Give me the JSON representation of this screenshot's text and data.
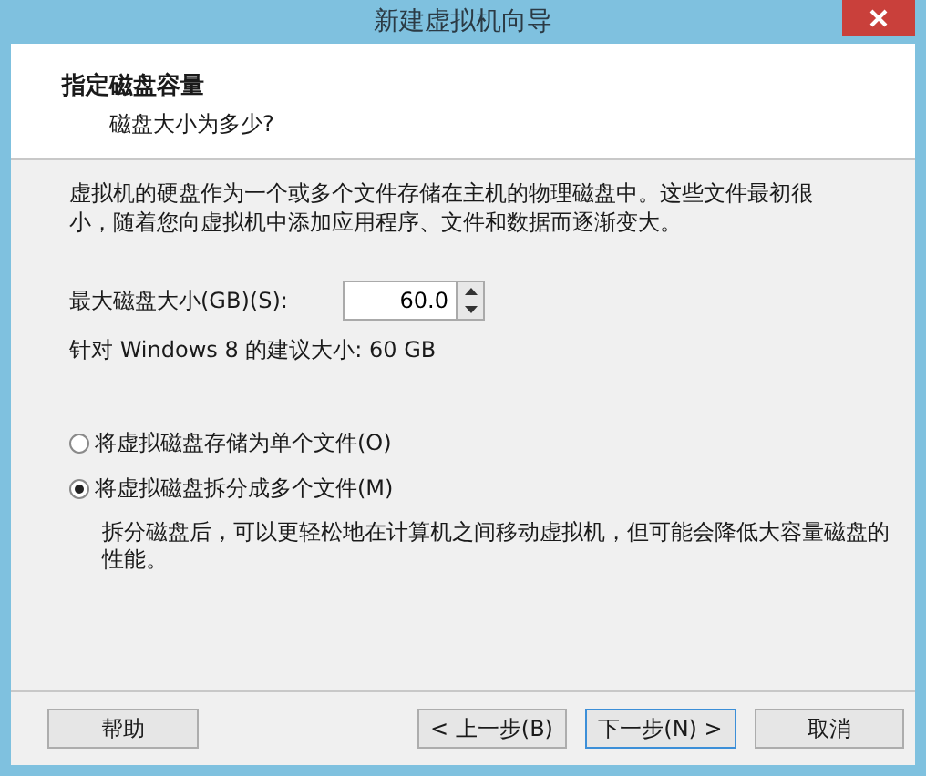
{
  "window": {
    "title": "新建虚拟机向导"
  },
  "header": {
    "title": "指定磁盘容量",
    "subtitle": "磁盘大小为多少?"
  },
  "description": "虚拟机的硬盘作为一个或多个文件存储在主机的物理磁盘中。这些文件最初很小，随着您向虚拟机中添加应用程序、文件和数据而逐渐变大。",
  "disk_size": {
    "label": "最大磁盘大小(GB)(S):",
    "value": "60.0"
  },
  "recommendation": "针对 Windows 8 的建议大小: 60 GB",
  "options": [
    {
      "label": "将虚拟磁盘存储为单个文件(O)",
      "selected": false
    },
    {
      "label": "将虚拟磁盘拆分成多个文件(M)",
      "selected": true,
      "note": "拆分磁盘后，可以更轻松地在计算机之间移动虚拟机，但可能会降低大容量磁盘的性能。"
    }
  ],
  "buttons": [
    {
      "label": "帮助",
      "default": false
    },
    {
      "label": "< 上一步(B)",
      "default": false
    },
    {
      "label": "下一步(N) >",
      "default": true
    },
    {
      "label": "取消",
      "default": false
    }
  ]
}
